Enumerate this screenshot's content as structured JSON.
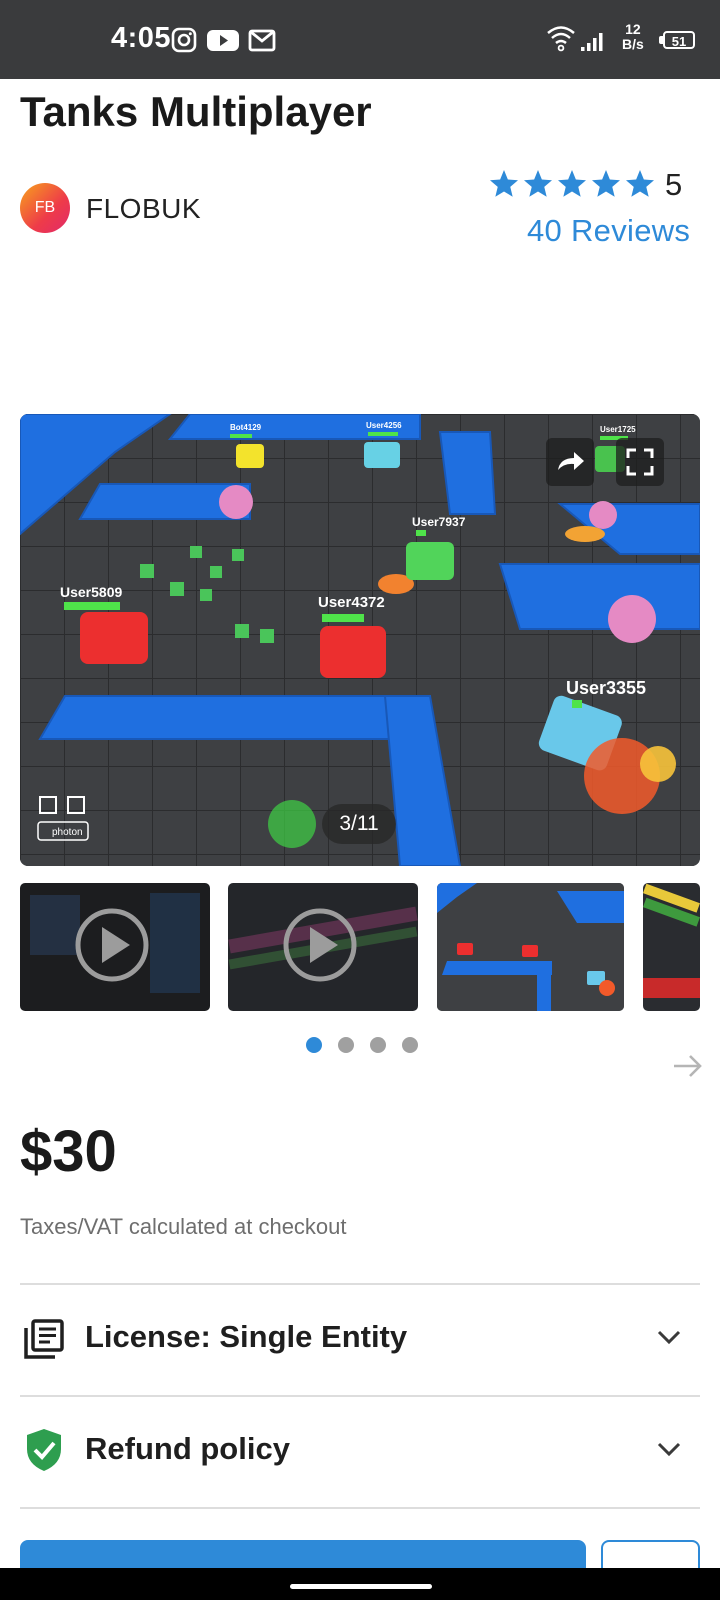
{
  "status_bar": {
    "time": "4:05",
    "net_speed_value": "12",
    "net_speed_unit": "B/s",
    "battery": "51",
    "icons": [
      "instagram-icon",
      "youtube-icon",
      "gmail-icon",
      "wifi-icon",
      "signal-icon"
    ]
  },
  "product": {
    "title": "Tanks Multiplayer",
    "seller": {
      "initials": "FB",
      "name": "FLOBUK"
    },
    "rating": {
      "stars": 5,
      "value": "5",
      "reviews": "40 Reviews",
      "star_color": "#2e8ad8"
    }
  },
  "gallery": {
    "counter": "3/11",
    "game_labels": {
      "bot": "Bot4129",
      "user_a": "User4256",
      "user_b": "User1725",
      "user_c": "User7937",
      "user_d": "User5809",
      "user_e": "User4372",
      "user_f": "User3355",
      "engine_logo": "photon"
    },
    "thumbnail_count": 4,
    "active_dot": 1,
    "dot_count": 4
  },
  "price": {
    "amount": "$30",
    "tax_note": "Taxes/VAT calculated at checkout"
  },
  "sections": {
    "license_label": "License: Single Entity",
    "refund_label": "Refund policy"
  },
  "colors": {
    "accent": "#2e8ad8",
    "status_bar": "#3a3b3d",
    "refund_shield": "#2e9e4f"
  }
}
